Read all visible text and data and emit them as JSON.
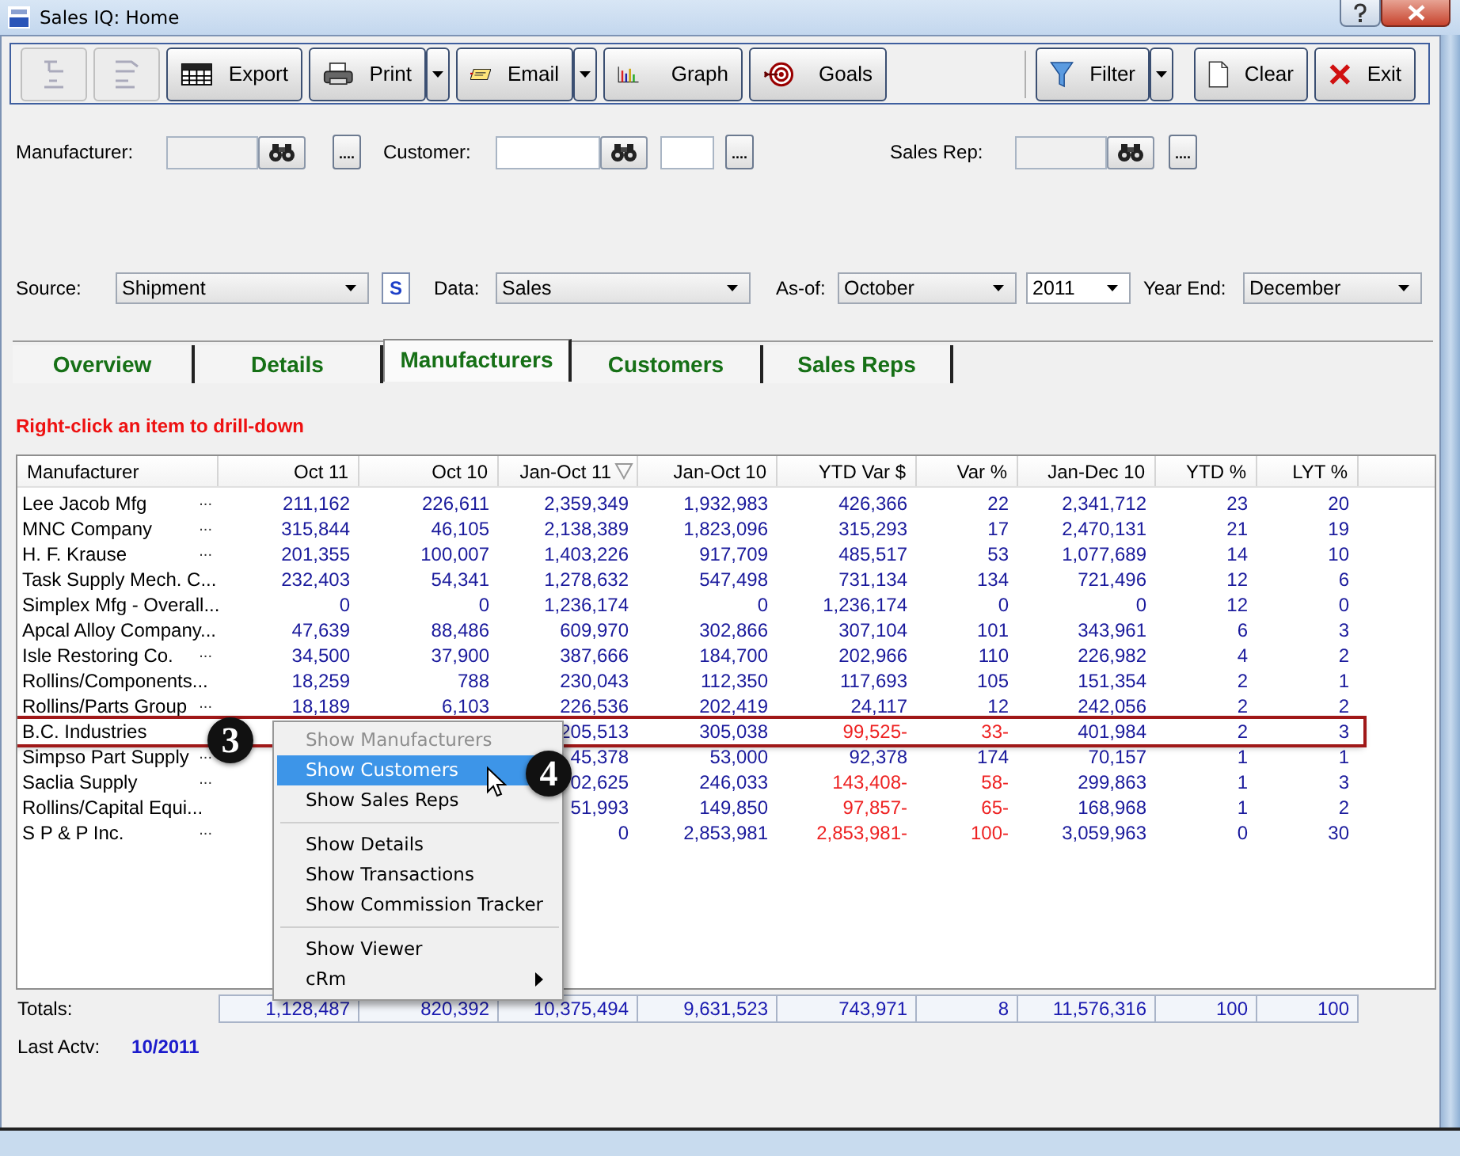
{
  "window": {
    "title": "Sales IQ: Home"
  },
  "toolbar": {
    "left": [
      {
        "kind": "icon",
        "disabled": true
      },
      {
        "kind": "icon",
        "disabled": true
      },
      {
        "kind": "labeled",
        "label": "Export",
        "disabled": false
      },
      {
        "kind": "labeled",
        "label": "Print",
        "disabled": false
      },
      {
        "kind": "dropdown",
        "disabled": false
      },
      {
        "kind": "labeled",
        "label": "Email",
        "disabled": false
      },
      {
        "kind": "dropdown",
        "disabled": false
      },
      {
        "kind": "labeled",
        "label": "Graph",
        "disabled": false
      },
      {
        "kind": "labeled",
        "label": "Goals",
        "disabled": false
      }
    ],
    "right": [
      {
        "kind": "labeled",
        "label": "Filter",
        "disabled": false
      },
      {
        "kind": "dropdown",
        "disabled": false
      },
      {
        "kind": "labeled",
        "label": "Clear",
        "disabled": false
      },
      {
        "kind": "labeled",
        "label": "Exit",
        "disabled": false
      }
    ]
  },
  "filters": [
    {
      "kind": "label",
      "text": "Manufacturer:"
    },
    {
      "kind": "lookup"
    },
    {
      "kind": "browse",
      "text": "...."
    },
    {
      "kind": "label",
      "text": "Customer:"
    },
    {
      "kind": "lookup"
    },
    {
      "kind": "field"
    },
    {
      "kind": "browse",
      "text": "...."
    },
    {
      "kind": "label",
      "text": "Sales Rep:"
    },
    {
      "kind": "lookup"
    },
    {
      "kind": "browse",
      "text": "...."
    }
  ],
  "source_row": [
    {
      "kind": "label",
      "text": "Source:"
    },
    {
      "kind": "select",
      "value": "Shipment"
    },
    {
      "kind": "button",
      "text": "S"
    },
    {
      "kind": "label",
      "text": "Data:"
    },
    {
      "kind": "select",
      "value": "Sales"
    },
    {
      "kind": "label",
      "text": "As-of:"
    },
    {
      "kind": "select",
      "value": "October"
    },
    {
      "kind": "select",
      "value": "2011"
    },
    {
      "kind": "label",
      "text": "Year End:"
    },
    {
      "kind": "select",
      "value": "December"
    }
  ],
  "tabs": [
    {
      "label": "Overview",
      "selected": false
    },
    {
      "label": "Details",
      "selected": false
    },
    {
      "label": "Manufacturers",
      "selected": true
    },
    {
      "label": "Customers",
      "selected": false
    },
    {
      "label": "Sales Reps",
      "selected": false
    }
  ],
  "hint": "Right-click an item to drill-down",
  "table": {
    "columns": [
      {
        "label": "Manufacturer",
        "kind": "name",
        "sorted": false
      },
      {
        "label": "Oct 11",
        "kind": "number",
        "sorted": false
      },
      {
        "label": "Oct 10",
        "kind": "number",
        "sorted": false
      },
      {
        "label": "Jan-Oct 11",
        "kind": "number",
        "sorted": true
      },
      {
        "label": "Jan-Oct 10",
        "kind": "number",
        "sorted": false
      },
      {
        "label": "YTD Var $",
        "kind": "variance",
        "sorted": false
      },
      {
        "label": "Var %",
        "kind": "variance",
        "sorted": false
      },
      {
        "label": "Jan-Dec 10",
        "kind": "number",
        "sorted": false
      },
      {
        "label": "YTD %",
        "kind": "number",
        "sorted": false
      },
      {
        "label": "LYT %",
        "kind": "number",
        "sorted": false
      }
    ],
    "rows": [
      {
        "more": "...",
        "cells": [
          "Lee Jacob Mfg",
          "211,162",
          "226,611",
          "2,359,349",
          "1,932,983",
          "426,366",
          "22",
          "2,341,712",
          "23",
          "20"
        ],
        "negative": false,
        "highlighted": false
      },
      {
        "more": "...",
        "cells": [
          "MNC Company",
          "315,844",
          "46,105",
          "2,138,389",
          "1,823,096",
          "315,293",
          "17",
          "2,470,131",
          "21",
          "19"
        ],
        "negative": false,
        "highlighted": false
      },
      {
        "more": "...",
        "cells": [
          "H. F. Krause",
          "201,355",
          "100,007",
          "1,403,226",
          "917,709",
          "485,517",
          "53",
          "1,077,689",
          "14",
          "10"
        ],
        "negative": false,
        "highlighted": false
      },
      {
        "cells": [
          "Task Supply Mech. C...",
          "232,403",
          "54,341",
          "1,278,632",
          "547,498",
          "731,134",
          "134",
          "721,496",
          "12",
          "6"
        ],
        "negative": false,
        "highlighted": false
      },
      {
        "cells": [
          "Simplex Mfg - Overall...",
          "0",
          "0",
          "1,236,174",
          "0",
          "1,236,174",
          "0",
          "0",
          "12",
          "0"
        ],
        "negative": false,
        "highlighted": false
      },
      {
        "cells": [
          "Apcal Alloy Company...",
          "47,639",
          "88,486",
          "609,970",
          "302,866",
          "307,104",
          "101",
          "343,961",
          "6",
          "3"
        ],
        "negative": false,
        "highlighted": false
      },
      {
        "more": "...",
        "cells": [
          "Isle Restoring Co.",
          "34,500",
          "37,900",
          "387,666",
          "184,700",
          "202,966",
          "110",
          "226,982",
          "4",
          "2"
        ],
        "negative": false,
        "highlighted": false
      },
      {
        "cells": [
          "Rollins/Components...",
          "18,259",
          "788",
          "230,043",
          "112,350",
          "117,693",
          "105",
          "151,354",
          "2",
          "1"
        ],
        "negative": false,
        "highlighted": false
      },
      {
        "more": "...",
        "cells": [
          "Rollins/Parts Group",
          "18,189",
          "6,103",
          "226,536",
          "202,419",
          "24,117",
          "12",
          "242,056",
          "2",
          "2"
        ],
        "negative": false,
        "highlighted": false
      },
      {
        "cells": [
          "B.C. Industries",
          "",
          "",
          "205,513",
          "305,038",
          "99,525-",
          "33-",
          "401,984",
          "2",
          "3"
        ],
        "negative": true,
        "highlighted": true
      },
      {
        "more": "...",
        "cells": [
          "Simpso Part Supply",
          "",
          "",
          "45,378",
          "53,000",
          "92,378",
          "174",
          "70,157",
          "1",
          "1"
        ],
        "negative": false,
        "highlighted": false
      },
      {
        "more": "...",
        "cells": [
          "Saclia Supply",
          "",
          "",
          "02,625",
          "246,033",
          "143,408-",
          "58-",
          "299,863",
          "1",
          "3"
        ],
        "negative": true,
        "highlighted": false
      },
      {
        "cells": [
          "Rollins/Capital Equi...",
          "",
          "",
          "51,993",
          "149,850",
          "97,857-",
          "65-",
          "168,968",
          "1",
          "2"
        ],
        "negative": true,
        "highlighted": false
      },
      {
        "more": "...",
        "cells": [
          "S P & P Inc.",
          "",
          "",
          "0",
          "2,853,981",
          "2,853,981-",
          "100-",
          "3,059,963",
          "0",
          "30"
        ],
        "negative": true,
        "highlighted": false
      }
    ],
    "totals": {
      "label": "Totals:",
      "cells": [
        "1,128,487",
        "820,392",
        "10,375,494",
        "9,631,523",
        "743,971",
        "8",
        "11,576,316",
        "100",
        "100"
      ]
    }
  },
  "last_activity": {
    "label": "Last Actv:",
    "value": "10/2011"
  },
  "context_menu": {
    "items": [
      {
        "kind": "item",
        "label": "Show Manufacturers",
        "disabled": true,
        "selected": false,
        "submenu": false
      },
      {
        "kind": "item",
        "label": "Show Customers",
        "disabled": false,
        "selected": true,
        "submenu": false
      },
      {
        "kind": "item",
        "label": "Show Sales Reps",
        "disabled": false,
        "selected": false,
        "submenu": false
      },
      {
        "kind": "separator"
      },
      {
        "kind": "item",
        "label": "Show Details",
        "disabled": false,
        "selected": false,
        "submenu": false
      },
      {
        "kind": "item",
        "label": "Show Transactions",
        "disabled": false,
        "selected": false,
        "submenu": false
      },
      {
        "kind": "item",
        "label": "Show Commission Tracker",
        "disabled": false,
        "selected": false,
        "submenu": false
      },
      {
        "kind": "separator"
      },
      {
        "kind": "item",
        "label": "Show Viewer",
        "disabled": false,
        "selected": false,
        "submenu": false
      },
      {
        "kind": "item",
        "label": "cRm",
        "disabled": false,
        "selected": false,
        "submenu": true
      }
    ]
  },
  "callouts": [
    {
      "text": "3"
    },
    {
      "text": "4"
    }
  ]
}
